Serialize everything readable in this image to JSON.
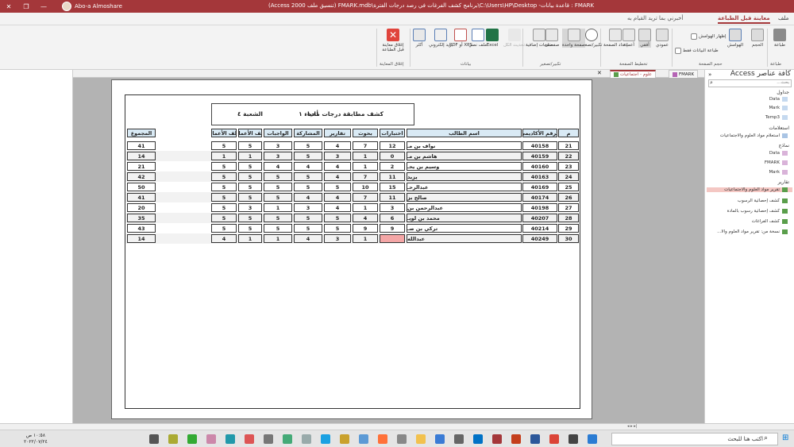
{
  "titlebar": {
    "title": "FMARK : قاعدة بيانات- C:\\Users\\HP\\Desktop\\برنامج كشف الفرغات في رصد درجات الفترة\\FMARK.mdb (تنسيق ملف Access 2000)",
    "app": "Access",
    "user": "Abo-a Almoshare"
  },
  "tabs": {
    "file": "ملف",
    "print_preview": "معاينة قبل الطباعة",
    "tell_me": "أخبرني بما تريد القيام به"
  },
  "ribbon": {
    "print": "طباعة",
    "size": "الحجم",
    "margins": "الهوامش",
    "show_margins": "إظهار الهوامش",
    "print_data_only": "طباعة البيانات فقط",
    "group_print": "طباعة",
    "group_page_size": "حجم الصفحة",
    "portrait": "عمودي",
    "landscape": "أفقي",
    "columns": "أعمدة",
    "page_setup": "إعداد الصفحة",
    "group_layout": "تخطيط الصفحة",
    "zoom": "تكبير/تصغير",
    "one_page": "صفحة واحدة",
    "two_pages": "صفحتان",
    "more_pages": "صفحات إضافية",
    "group_zoom": "تكبير/تصغير",
    "refresh_all": "تحديث الكل",
    "excel": "Excel",
    "text_file": "ملف نصي",
    "pdf": "PDF أو XPS",
    "email": "بريد إلكتروني",
    "more": "أكثر",
    "group_data": "بيانات",
    "close_preview": "إغلاق معاينة قبل الطباعة",
    "group_close": "إغلاق المعاينة"
  },
  "doc_tabs": [
    "علوم - اجتماعيات",
    "FMARK"
  ],
  "report": {
    "title": "كشف مطابقة درجات مادة",
    "subject": "أحياء ١",
    "section": "الشعبة ٤",
    "columns": [
      "م",
      "الرقم الأكاديمي",
      "اسم الطالب",
      "اختبارات",
      "بحوث",
      "تقارير",
      "المشاركة",
      "الواجبات",
      "ملف الأعمال",
      "ملف الأعمال",
      "المجموع"
    ],
    "rows": [
      [
        "21",
        "40158",
        "نواف بن مـ",
        "12",
        "7",
        "4",
        "5",
        "3",
        "5",
        "5",
        "41"
      ],
      [
        "22",
        "40159",
        "هاشم بن مـ",
        "0",
        "1",
        "3",
        "5",
        "3",
        "1",
        "1",
        "14"
      ],
      [
        "23",
        "40160",
        "وسيم بن يحـ",
        "2",
        "1",
        "4",
        "4",
        "4",
        "5",
        "5",
        "21"
      ],
      [
        "24",
        "40163",
        "يزيد",
        "11",
        "7",
        "4",
        "5",
        "5",
        "5",
        "5",
        "42"
      ],
      [
        "25",
        "40169",
        "عبدالرحـ",
        "15",
        "10",
        "5",
        "5",
        "5",
        "5",
        "5",
        "50"
      ],
      [
        "26",
        "40174",
        "صالح بز",
        "11",
        "7",
        "4",
        "4",
        "5",
        "5",
        "5",
        "41"
      ],
      [
        "27",
        "40198",
        "عبدالرحمن بن",
        "3",
        "1",
        "4",
        "3",
        "1",
        "3",
        "5",
        "20"
      ],
      [
        "28",
        "40207",
        "محمد بن لويـ",
        "6",
        "4",
        "5",
        "5",
        "5",
        "5",
        "5",
        "35"
      ],
      [
        "29",
        "40214",
        "تركي بن صـ",
        "9",
        "9",
        "5",
        "5",
        "5",
        "5",
        "5",
        "43"
      ],
      [
        "30",
        "40249",
        "عبدالله",
        "",
        "1",
        "3",
        "4",
        "1",
        "1",
        "4",
        "14"
      ]
    ]
  },
  "nav": {
    "title": "كافة عناصر Access",
    "search_placeholder": "بحث...",
    "sections": {
      "tables": "جداول",
      "queries": "استعلامات",
      "forms": "نماذج",
      "reports": "تقارير"
    },
    "tables": [
      "Data",
      "Mark",
      "Temp3"
    ],
    "queries": [
      "استعلام مواد العلوم والاجتماعيات"
    ],
    "forms": [
      "Data",
      "FMARK",
      "Mark"
    ],
    "reports": [
      "تقرير مواد العلوم والاجتماعيات",
      "كشف إحصائية الرسوب",
      "كشف إحصائية رسوب بالمادة",
      "كشف الفراغات",
      "نسخة من: تقرير مواد العلوم والا..."
    ]
  },
  "taskbar": {
    "search": "اكتب هنا للبحث",
    "time": "١٠:٥٨ ص",
    "date": "٢٠٢٢/٠٧/٢٤"
  },
  "colors": {
    "accent": "#a4373a",
    "header_cell": "#d9eaf5",
    "empty_cell": "#f4a6a6"
  }
}
